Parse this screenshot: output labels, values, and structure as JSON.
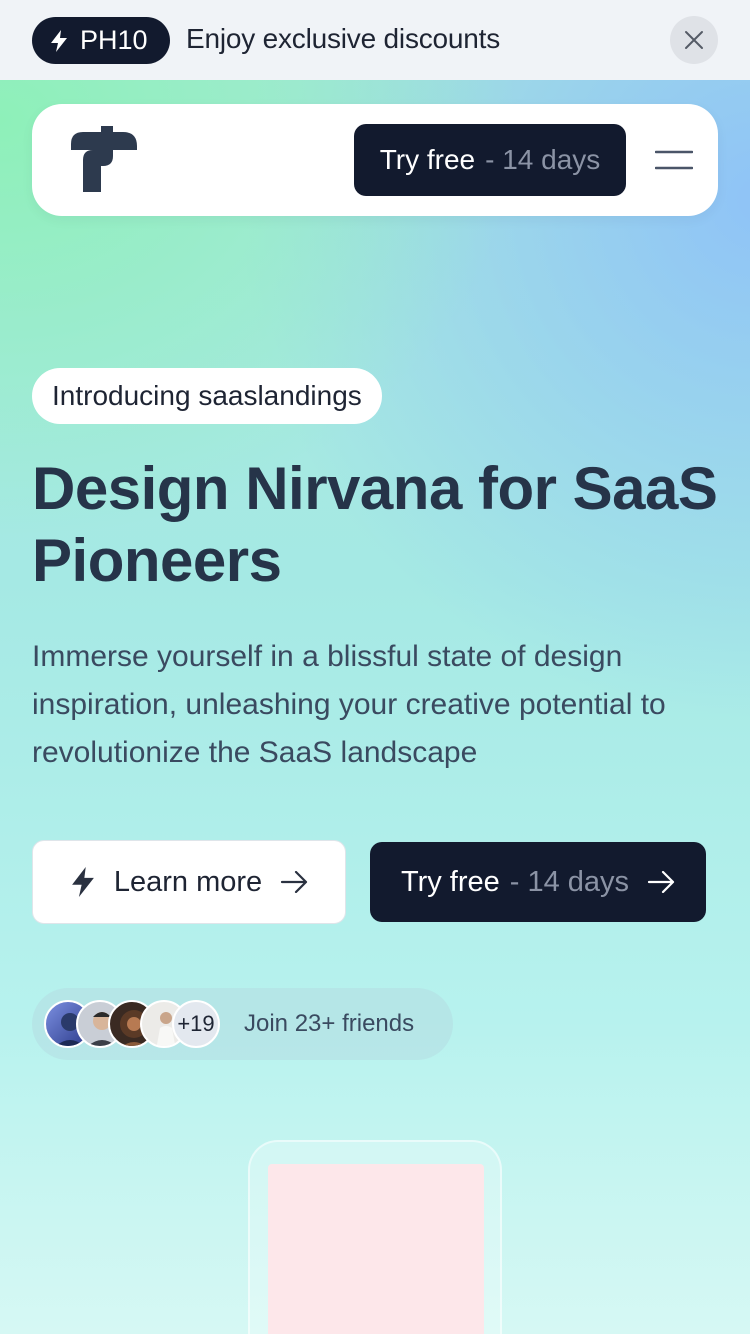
{
  "promo": {
    "code": "PH10",
    "message": "Enjoy exclusive discounts"
  },
  "nav": {
    "cta_label": "Try free",
    "cta_suffix": "- 14 days"
  },
  "hero": {
    "badge": "Introducing saaslandings",
    "headline": "Design Nirvana for SaaS Pioneers",
    "subhead": "Immerse yourself in a blissful state of design inspiration, unleashing your creative potential to revolutionize the SaaS landscape",
    "learn_more_label": "Learn more",
    "try_label": "Try free",
    "try_suffix": "- 14 days"
  },
  "social": {
    "extra_count": "+19",
    "text": "Join 23+ friends"
  },
  "colors": {
    "dark": "#121a2e",
    "heading": "#263449",
    "muted": "#8b93a5",
    "phone_screen": "#fde7ea"
  }
}
